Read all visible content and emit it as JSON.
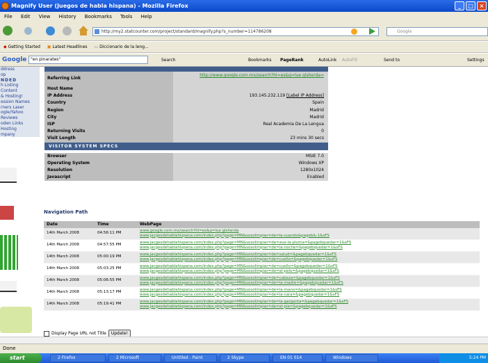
{
  "window": {
    "title": "Magnify User (Juegos de habla hispana) - Mozilla Firefox"
  },
  "menu": [
    "File",
    "Edit",
    "View",
    "History",
    "Bookmarks",
    "Tools",
    "Help"
  ],
  "address": {
    "url": "http://my2.statcounter.com/project/standard/magnify.php?s_number=114786208"
  },
  "search_box": {
    "placeholder": "Google"
  },
  "bookmarks": [
    "Getting Started",
    "Latest Headlines",
    "Diccionario de la leng..."
  ],
  "google_toolbar": {
    "query": "\"en pinarates\"",
    "search_label": "Search",
    "bookmarks_label": "Bookmarks",
    "pagerank_label": "PageRank",
    "autolink_label": "AutoLink",
    "autofill_label": "AutoFill",
    "sendto_label": "Send to",
    "settings_label": "Settings"
  },
  "sidebar": {
    "items": [
      "ddress",
      "op",
      "NDED",
      "h Listing",
      "Content",
      "& Hosting!",
      "ession Names",
      "rners Laser",
      "ogle/Yahoo",
      "Reviews",
      "oden Links",
      "Hosting",
      "mpany"
    ]
  },
  "visitor": {
    "referring_label": "Referring Link",
    "referring_value": "http://www.google.com.mx/search?hl=es&q=lue glsherda=",
    "rows": [
      {
        "k": "Host Name",
        "v": ""
      },
      {
        "k": "IP Address",
        "v": "193.145.232.119",
        "extra": "[Label IP Address]"
      },
      {
        "k": "Country",
        "v": "Spain"
      },
      {
        "k": "Region",
        "v": "Madrid"
      },
      {
        "k": "City",
        "v": "Madrid"
      },
      {
        "k": "ISP",
        "v": "Real Academia De La Lengua"
      },
      {
        "k": "Returning Visits",
        "v": "0"
      },
      {
        "k": "Visit Length",
        "v": "23 mins 30 secs"
      }
    ],
    "specs_header": "VISITOR SYSTEM SPECS",
    "specs": [
      {
        "k": "Browser",
        "v": "MSIE 7.0"
      },
      {
        "k": "Operating System",
        "v": "Windows XP"
      },
      {
        "k": "Resolution",
        "v": "1280x1024"
      },
      {
        "k": "Javascript",
        "v": "Enabled"
      }
    ]
  },
  "navigation": {
    "title": "Navigation Path",
    "headers": [
      "Date",
      "Time",
      "WebPage"
    ],
    "rows": [
      {
        "date": "14th March 2008",
        "time": "04:56:11 PM",
        "pages": [
          "www.google.com.mx/search?hl=es&q=lue glsherda",
          "www.jacgesdehablahispana.com/index.php?page=MN&sosolimpiar=de=la-cuando&pageb&-1&sFS"
        ]
      },
      {
        "date": "14th March 2008",
        "time": "04:57:55 PM",
        "pages": [
          "www.jacgesdehablahispana.com/index.php?page=MN&sosolimpiar=de=ave-la-pluma=&pagebquedar=1&sFS",
          "www.jacgesdehablahispana.com/index.php?page=MN&sosolimpiar=de=la-noche=&pagebquedar=1&sFS"
        ]
      },
      {
        "date": "14th March 2008",
        "time": "05:00:19 PM",
        "pages": [
          "www.jacgesdehablahispana.com/index.php?page=MN&sosolimpiar=de=salud=&pagebquedar=1&sFS",
          "www.jacgesdehablahispana.com/index.php?page=MN&sosolimpiar=de=cuello=&pagebquedar=1&sFS"
        ]
      },
      {
        "date": "14th March 2008",
        "time": "05:03:25 PM",
        "pages": [
          "www.jacgesdehablahispana.com/index.php?page=MN&sosolimpiar=de=cuello=&pagebquedar=1&sFS",
          "www.jacgesdehablahispana.com/index.php?page=MN&sosolimpiar=de=el-pelo=&pagebquedar=1&sFS"
        ]
      },
      {
        "date": "14th March 2008",
        "time": "05:06:55 PM",
        "pages": [
          "www.jacgesdehablahispana.com/index.php?page=MN&sosolimpiar=de=cabeza=&pagebquedar=1&sFS",
          "www.jacgesdehablahispana.com/index.php?page=MN&sosolimpiar=de=la-madre=&pagebquedar=1&sFS"
        ]
      },
      {
        "date": "14th March 2008",
        "time": "05:13:17 PM",
        "pages": [
          "www.jacgesdehablahispana.com/index.php?page=MN&sosolimpiar=de=la-mano=&pagebquedar=1&sFS",
          "www.jacgesdehablahispana.com/index.php?page=MN&sosolimpiar=de=la-cara=&pagebquedar=1&sFS"
        ]
      },
      {
        "date": "14th March 2008",
        "time": "05:19:41 PM",
        "pages": [
          "www.jacgesdehablahispana.com/index.php?page=MN&sosolimpiar=de=la-garganta=&pagebquedar=1&sFS",
          "www.jacgesdehablahispana.com/index.php?page=MN&sosolimpiar=de=el-pie=&pagebquedar=1&sFS"
        ]
      }
    ]
  },
  "display_option": {
    "label": "Display Page URL not Title",
    "button": "Update!"
  },
  "status": "Done",
  "taskbar": {
    "start": "start",
    "items": [
      "2 Firefox",
      "2 Microsoft",
      "Untitled - Paint",
      "2 Skype",
      "EN 01 014",
      "Windows"
    ],
    "clock": "5:24 PM"
  }
}
